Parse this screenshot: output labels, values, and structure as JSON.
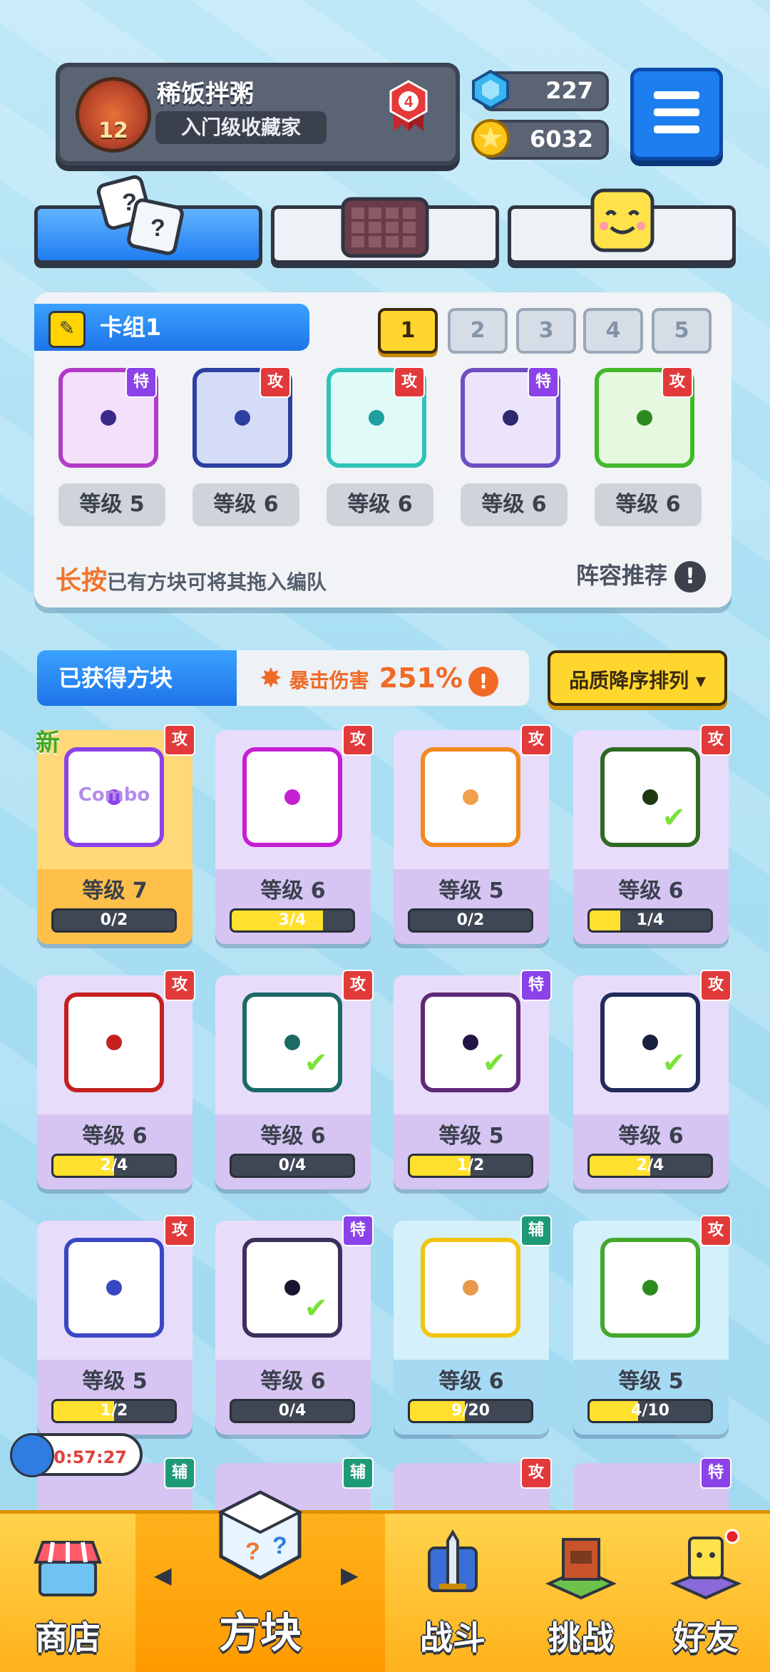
{
  "player": {
    "name": "稀饭拌粥",
    "title": "入门级收藏家",
    "level": "12",
    "rank": "4"
  },
  "currency": {
    "gems": "227",
    "coins": "6032"
  },
  "deck": {
    "title": "卡组1",
    "slots": [
      "1",
      "2",
      "3",
      "4",
      "5"
    ],
    "selected": "1",
    "dice": [
      {
        "level": "等级 5",
        "tag": "特",
        "color": "#b33ac8",
        "dot": "#3a2a8a"
      },
      {
        "level": "等级 6",
        "tag": "攻",
        "color": "#2d3fa0",
        "dot": "#2d3fa0"
      },
      {
        "level": "等级 6",
        "tag": "攻",
        "color": "#2fc4b8",
        "dot": "#1f9fa0"
      },
      {
        "level": "等级 6",
        "tag": "特",
        "color": "#6d4ec2",
        "dot": "#2d2870"
      },
      {
        "level": "等级 6",
        "tag": "攻",
        "color": "#43b82a",
        "dot": "#2d8a1f"
      }
    ],
    "hint_strong": "长按",
    "hint_rest": "已有方块可将其拖入编队",
    "recommend": "阵容推荐",
    "recommend_icon": "!"
  },
  "obtained": {
    "label": "已获得方块",
    "crit_label": "暴击伤害",
    "crit_value": "251%",
    "crit_icon": "!",
    "sort": "品质降序排列 ▾"
  },
  "cards": [
    {
      "level": "等级 7",
      "progress": "0/2",
      "frac": 0,
      "tag": "攻",
      "style": "gold",
      "color": "#8b42e8",
      "dot": "#8b42e8",
      "isnew": true,
      "text": "Combo"
    },
    {
      "level": "等级 6",
      "progress": "3/4",
      "frac": 0.75,
      "tag": "攻",
      "style": "",
      "color": "#c51fd4",
      "dot": "#c51fd4"
    },
    {
      "level": "等级 5",
      "progress": "0/2",
      "frac": 0,
      "tag": "攻",
      "style": "",
      "color": "#f08a1e",
      "dot": "#f0a04a"
    },
    {
      "level": "等级 6",
      "progress": "1/4",
      "frac": 0.25,
      "tag": "攻",
      "style": "",
      "color": "#2f6a22",
      "dot": "#1f3a12",
      "checked": true
    },
    {
      "level": "等级 6",
      "progress": "2/4",
      "frac": 0.5,
      "tag": "攻",
      "style": "",
      "color": "#c42020",
      "dot": "#c42020"
    },
    {
      "level": "等级 6",
      "progress": "0/4",
      "frac": 0,
      "tag": "攻",
      "style": "",
      "color": "#1c6a64",
      "dot": "#1c6a64",
      "checked": true
    },
    {
      "level": "等级 5",
      "progress": "1/2",
      "frac": 0.5,
      "tag": "特",
      "style": "",
      "color": "#5c2a78",
      "dot": "#231446",
      "checked": true
    },
    {
      "level": "等级 6",
      "progress": "2/4",
      "frac": 0.5,
      "tag": "攻",
      "style": "",
      "color": "#232a5c",
      "dot": "#1a1f40",
      "checked": true
    },
    {
      "level": "等级 5",
      "progress": "1/2",
      "frac": 0.5,
      "tag": "攻",
      "style": "",
      "color": "#3a47c4",
      "dot": "#3a47c4"
    },
    {
      "level": "等级 6",
      "progress": "0/4",
      "frac": 0,
      "tag": "特",
      "style": "",
      "color": "#3d2f5c",
      "dot": "#1a1430",
      "checked": true
    },
    {
      "level": "等级 6",
      "progress": "9/20",
      "frac": 0.45,
      "tag": "辅",
      "style": "blue",
      "color": "#f2c40f",
      "dot": "#e89a4a"
    },
    {
      "level": "等级 5",
      "progress": "4/10",
      "frac": 0.4,
      "tag": "攻",
      "style": "blue",
      "color": "#45a82d",
      "dot": "#2d8a1f"
    }
  ],
  "peek_tags": [
    "辅",
    "辅",
    "攻",
    "特"
  ],
  "timer": "00:57:27",
  "nav": {
    "shop": "商店",
    "dice": "方块",
    "battle": "战斗",
    "challenge": "挑战",
    "friends": "好友",
    "left_arrow": "◀",
    "right_arrow": "▶"
  }
}
